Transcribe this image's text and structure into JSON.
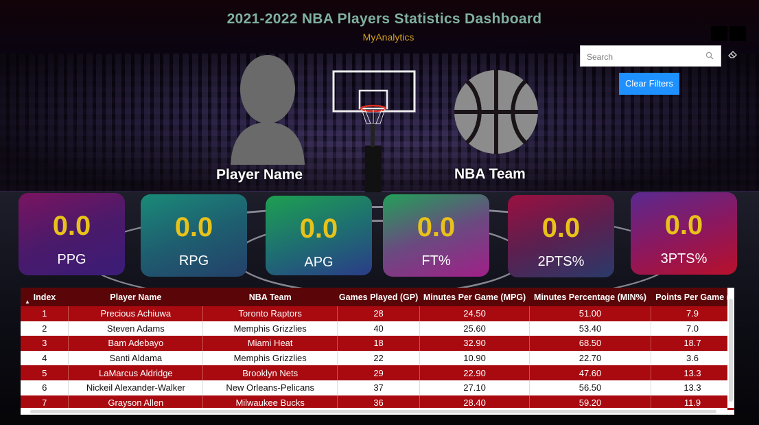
{
  "header": {
    "title": "2021-2022 NBA Players Statistics Dashboard",
    "subtitle": "MyAnalytics"
  },
  "search": {
    "placeholder": "Search"
  },
  "clear_filters_label": "Clear Filters",
  "slots": {
    "player_label": "Player Name",
    "team_label": "NBA Team"
  },
  "kpis": [
    {
      "value": "0.0",
      "label": "PPG"
    },
    {
      "value": "0.0",
      "label": "RPG"
    },
    {
      "value": "0.0",
      "label": "APG"
    },
    {
      "value": "0.0",
      "label": "FT%"
    },
    {
      "value": "0.0",
      "label": "2PTS%"
    },
    {
      "value": "0.0",
      "label": "3PTS%"
    }
  ],
  "table": {
    "columns": [
      "Index",
      "Player Name",
      "NBA Team",
      "Games Played (GP)",
      "Minutes Per Game (MPG)",
      "Minutes Percentage (MIN%)",
      "Points Per Game ("
    ],
    "rows": [
      [
        "1",
        "Precious Achiuwa",
        "Toronto Raptors",
        "28",
        "24.50",
        "51.00",
        "7.9"
      ],
      [
        "2",
        "Steven Adams",
        "Memphis Grizzlies",
        "40",
        "25.60",
        "53.40",
        "7.0"
      ],
      [
        "3",
        "Bam Adebayo",
        "Miami Heat",
        "18",
        "32.90",
        "68.50",
        "18.7"
      ],
      [
        "4",
        "Santi Aldama",
        "Memphis Grizzlies",
        "22",
        "10.90",
        "22.70",
        "3.6"
      ],
      [
        "5",
        "LaMarcus Aldridge",
        "Brooklyn Nets",
        "29",
        "22.90",
        "47.60",
        "13.3"
      ],
      [
        "6",
        "Nickeil Alexander-Walker",
        "New Orleans-Pelicans",
        "37",
        "27.10",
        "56.50",
        "13.3"
      ],
      [
        "7",
        "Grayson Allen",
        "Milwaukee Bucks",
        "36",
        "28.40",
        "59.20",
        "11.9"
      ]
    ]
  }
}
